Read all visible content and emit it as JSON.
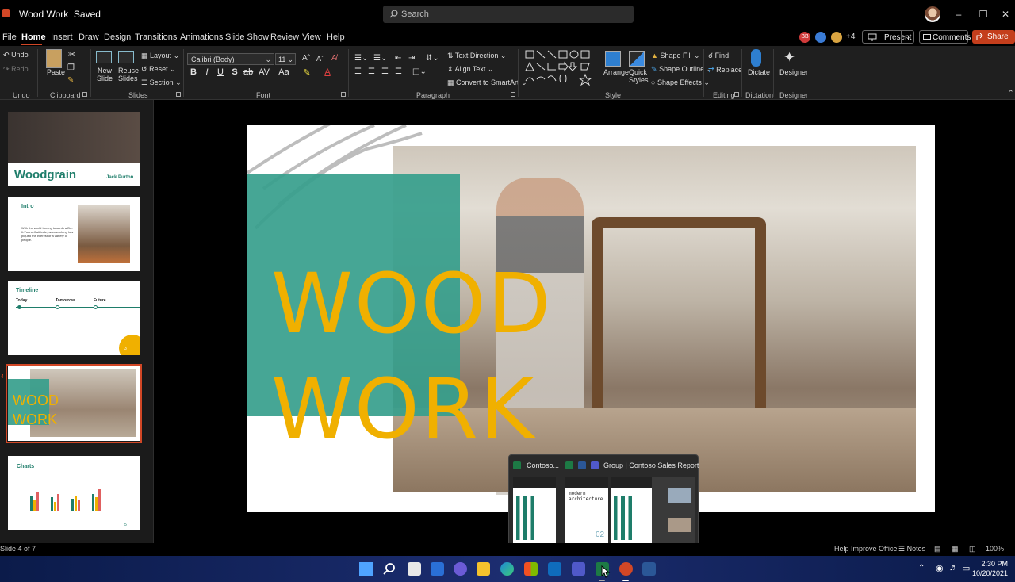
{
  "window": {
    "title": "Wood Work",
    "status": "Saved",
    "search_placeholder": "Search"
  },
  "menu": {
    "tabs": [
      "File",
      "Home",
      "Insert",
      "Draw",
      "Design",
      "Transitions",
      "Animations",
      "Slide Show",
      "Review",
      "View",
      "Help"
    ],
    "active": "Home"
  },
  "collaborators": {
    "initials": "BB",
    "extra_count": "+4"
  },
  "actions": {
    "present": "Present",
    "comments": "Comments",
    "share": "Share"
  },
  "ribbon": {
    "undo": {
      "undo": "Undo",
      "redo": "Redo",
      "group": "Undo"
    },
    "clipboard": {
      "paste": "Paste",
      "group": "Clipboard"
    },
    "slides": {
      "new_slide": "New Slide",
      "reuse_slides": "Reuse Slides",
      "layout": "Layout",
      "reset": "Reset",
      "section": "Section",
      "group": "Slides"
    },
    "font": {
      "name": "Calibri (Body)",
      "size": "11",
      "group": "Font",
      "bold": "B",
      "italic": "I",
      "underline": "U",
      "shadow": "S"
    },
    "paragraph": {
      "text_direction": "Text Direction",
      "align_text": "Align Text",
      "convert_smartart": "Convert to SmartArt",
      "group": "Paragraph"
    },
    "style": {
      "arrange": "Arrange",
      "quick_styles": "Quick Styles",
      "shape_fill": "Shape Fill",
      "shape_outline": "Shape Outline",
      "shape_effects": "Shape Effects",
      "group": "Style"
    },
    "editing": {
      "find": "Find",
      "replace": "Replace",
      "group": "Editing"
    },
    "dictation": {
      "dictate": "Dictate",
      "group": "Dictation"
    },
    "designer": {
      "designer": "Designer",
      "group": "Designer"
    }
  },
  "slides": [
    {
      "title": "Woodgrain",
      "author": "Jack Purton"
    },
    {
      "title": "Intro",
      "body": "With the world turning towards a Do-It-Yourself attitude, woodworking has piqued the interest of a variety of people."
    },
    {
      "title": "Timeline",
      "cols": [
        "Today",
        "Tomorrow",
        "Future"
      ],
      "page": "3"
    },
    {
      "line1": "WOOD",
      "line2": "WORK"
    },
    {
      "title": "Charts",
      "page": "5"
    }
  ],
  "main_slide": {
    "line1": "WOOD",
    "line2": "WORK"
  },
  "status": {
    "slide_info": "Slide 4 of 7",
    "help": "Help Improve Office",
    "notes": "Notes",
    "zoom": "100%"
  },
  "preview": {
    "title1": "Contoso...",
    "title2": "Group | Contoso Sales Report",
    "doc_text": "modern architecture",
    "doc_num": "02"
  },
  "clock": {
    "time": "2:30 PM",
    "date": "10/20/2021"
  },
  "colors": {
    "accent": "#d24726",
    "teal": "#369e8c",
    "gold": "#f0b000",
    "taskbar": "#1c2d70"
  }
}
